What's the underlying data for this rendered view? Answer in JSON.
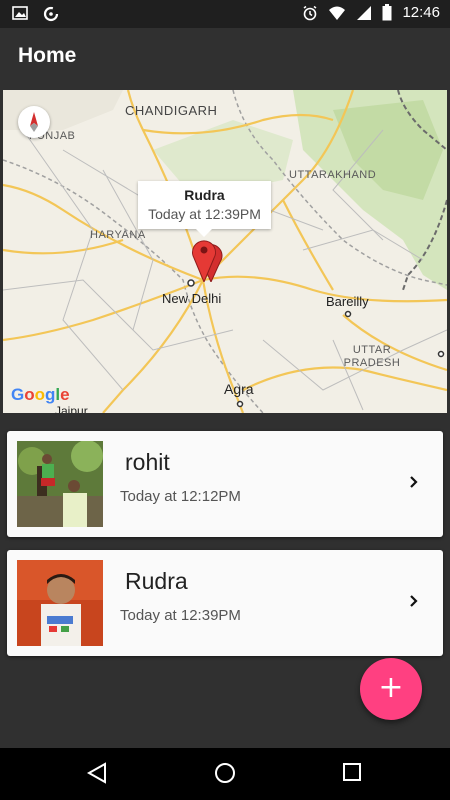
{
  "status_bar": {
    "time": "12:46",
    "left_icons": [
      "image-icon",
      "sync-icon"
    ],
    "right_icons": [
      "alarm-icon",
      "wifi-icon",
      "signal-icon",
      "battery-icon"
    ]
  },
  "app_bar": {
    "title": "Home"
  },
  "map": {
    "regions": [
      "CHANDIGARH",
      "PUNJAB",
      "UTTARAKHAND",
      "HARYANA",
      "UTTAR PRADESH"
    ],
    "cities": [
      "New Delhi",
      "Bareilly",
      "Agra",
      "Jaipur"
    ],
    "info_window": {
      "title": "Rudra",
      "time": "Today at 12:39PM"
    },
    "logo": "Google"
  },
  "entries": [
    {
      "name": "rohit",
      "time": "Today at 12:12PM"
    },
    {
      "name": "Rudra",
      "time": "Today at 12:39PM"
    }
  ],
  "fab": {
    "label": "+",
    "icon": "add-icon"
  },
  "nav_bar": {
    "icons": [
      "back-icon",
      "home-icon",
      "recents-icon"
    ]
  }
}
